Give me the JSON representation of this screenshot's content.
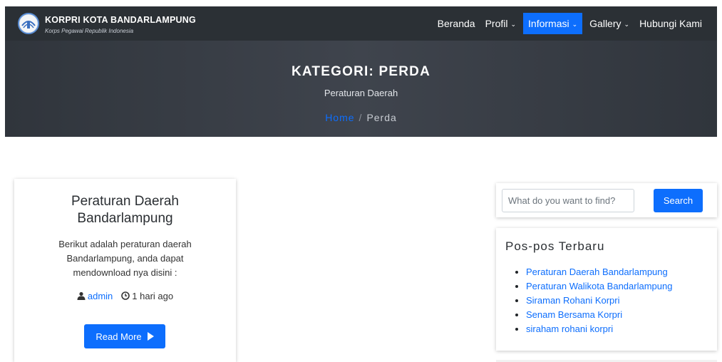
{
  "brand": {
    "title": "KORPRI KOTA BANDARLAMPUNG",
    "subtitle": "Korps Pegawai Republik Indonesia"
  },
  "nav": {
    "items": [
      {
        "label": "Beranda",
        "dropdown": false
      },
      {
        "label": "Profil",
        "dropdown": true
      },
      {
        "label": "Informasi",
        "dropdown": true,
        "active": true
      },
      {
        "label": "Gallery",
        "dropdown": true
      },
      {
        "label": "Hubungi Kami",
        "dropdown": false
      }
    ]
  },
  "hero": {
    "title": "KATEGORI: PERDA",
    "subtitle": "Peraturan Daerah",
    "breadcrumb": {
      "home": "Home",
      "separator": "/",
      "current": "Perda"
    }
  },
  "post": {
    "title": "Peraturan Daerah Bandarlampung",
    "excerpt": "Berikut adalah peraturan daerah Bandarlampung, anda dapat mendownload nya disini :",
    "author": "admin",
    "time": "1 hari ago",
    "read_more": "Read More"
  },
  "search": {
    "placeholder": "What do you want to find?",
    "value": "",
    "button": "Search"
  },
  "recent": {
    "title": "Pos-pos Terbaru",
    "items": [
      "Peraturan Daerah Bandarlampung",
      "Peraturan Walikota Bandarlampung",
      "Siraman Rohani Korpri",
      "Senam Bersama Korpri",
      "siraham rohani korpri"
    ]
  },
  "colors": {
    "accent": "#0d6efd",
    "navbar": "#2b3035",
    "hero": "#3a3f47"
  }
}
